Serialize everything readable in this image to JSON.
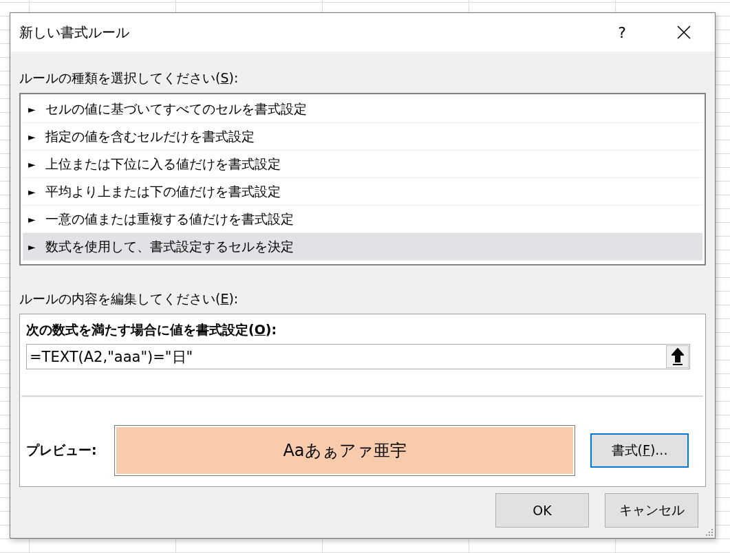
{
  "window": {
    "title": "新しい書式ルール",
    "help": "?"
  },
  "rule_type": {
    "label": {
      "before": "ルールの種類を選択してください(",
      "access_key": "S",
      "after": "):"
    },
    "items": [
      {
        "arrow": "►",
        "label": "セルの値に基づいてすべてのセルを書式設定",
        "selected": false
      },
      {
        "arrow": "►",
        "label": "指定の値を含むセルだけを書式設定",
        "selected": false
      },
      {
        "arrow": "►",
        "label": "上位または下位に入る値だけを書式設定",
        "selected": false
      },
      {
        "arrow": "►",
        "label": "平均より上または下の値だけを書式設定",
        "selected": false
      },
      {
        "arrow": "►",
        "label": "一意の値または重複する値だけを書式設定",
        "selected": false
      },
      {
        "arrow": "►",
        "label": "数式を使用して、書式設定するセルを決定",
        "selected": true
      }
    ]
  },
  "rule_edit": {
    "label": {
      "before": "ルールの内容を編集してください(",
      "access_key": "E",
      "after": "):"
    },
    "formula_label": {
      "before": "次の数式を満たす場合に値を書式設定(",
      "access_key": "O",
      "after": "):"
    },
    "formula": "=TEXT(A2,\"aaa\")=\"日\"",
    "preview_label": "プレビュー:",
    "preview_text": "Aaあぁアァ亜宇",
    "format_button": {
      "before": "書式(",
      "access_key": "F",
      "after": ")..."
    }
  },
  "buttons": [
    "OK",
    "キャンセル"
  ]
}
